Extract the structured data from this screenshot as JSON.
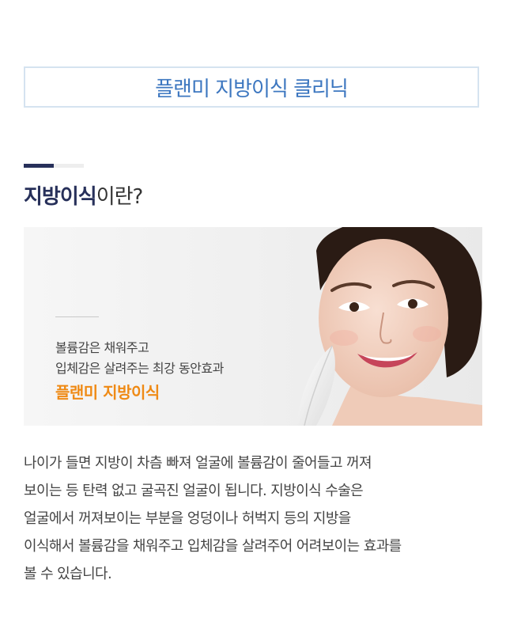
{
  "header": {
    "title": "플랜미 지방이식 클리닉"
  },
  "section": {
    "title_strong": "지방이식",
    "title_rest": "이란?"
  },
  "banner": {
    "line1": "볼륨감은 채워주고",
    "line2": "입체감은 살려주는 최강 동안효과",
    "brand": "플랜미 지방이식"
  },
  "description": {
    "lines": [
      "나이가 들면 지방이 차츰 빠져 얼굴에 볼륨감이 줄어들고 꺼져",
      "보이는 등 탄력 없고 굴곡진 얼굴이 됩니다. 지방이식 수술은",
      "얼굴에서 꺼져보이는 부분을 엉덩이나 허벅지 등의 지방을",
      "이식해서 볼륨감을 채워주고 입체감을 살려주어 어려보이는 효과를",
      "볼 수 있습니다."
    ]
  },
  "colors": {
    "title_blue": "#3d77c0",
    "navy": "#27305a",
    "brand_orange": "#ef8a15",
    "box_border": "#d5e3f0"
  }
}
